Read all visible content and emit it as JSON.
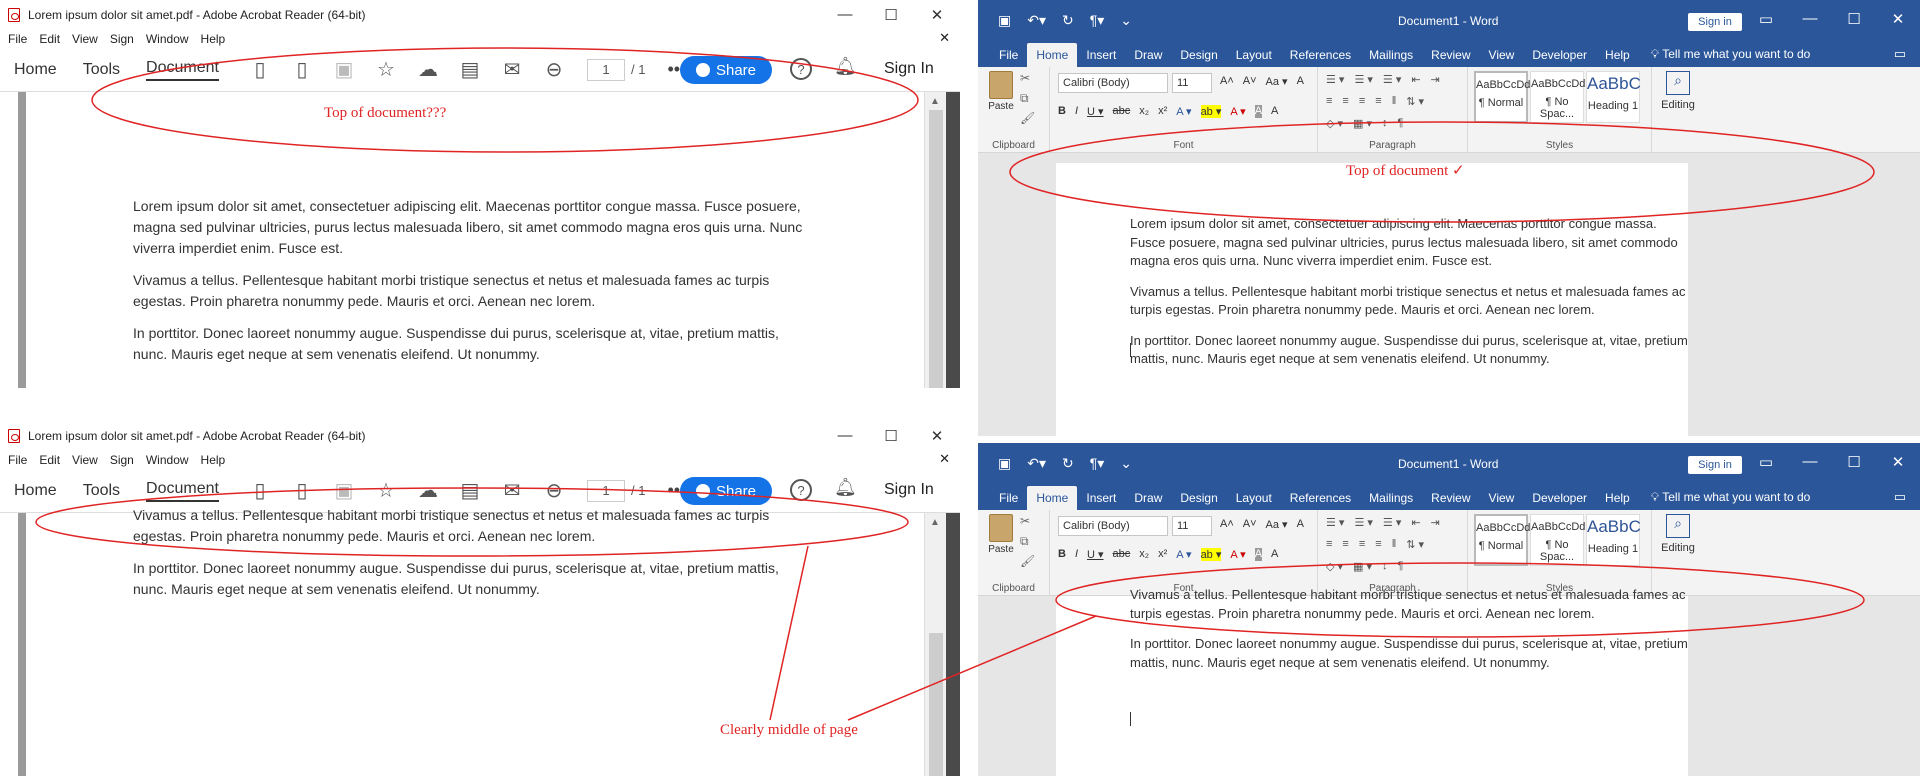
{
  "acrobat": {
    "title": "Lorem ipsum dolor sit amet.pdf - Adobe Acrobat Reader (64-bit)",
    "window_controls": [
      "—",
      "☐",
      "✕"
    ],
    "menu": [
      "File",
      "Edit",
      "View",
      "Sign",
      "Window",
      "Help"
    ],
    "menu_close": "✕",
    "nav": [
      "Home",
      "Tools",
      "Document"
    ],
    "page_current": "1",
    "page_total": "/ 1",
    "more": "•••",
    "share_label": "Share",
    "help_label": "?",
    "signin_label": "Sign In",
    "paragraphs": [
      "Lorem ipsum dolor sit amet, consectetuer adipiscing elit. Maecenas porttitor congue massa. Fusce posuere, magna sed pulvinar ultricies, purus lectus malesuada libero, sit amet commodo magna eros quis urna. Nunc viverra imperdiet enim. Fusce est.",
      "Vivamus a tellus. Pellentesque habitant morbi tristique senectus et netus et malesuada fames ac turpis egestas. Proin pharetra nonummy pede. Mauris et orci. Aenean nec lorem.",
      "In porttitor. Donec laoreet nonummy augue. Suspendisse dui purus, scelerisque at, vitae, pretium mattis, nunc. Mauris eget neque at sem venenatis eleifend. Ut nonummy."
    ],
    "scrolled_paragraphs": [
      "Vivamus a tellus. Pellentesque habitant morbi tristique senectus et netus et malesuada fames ac turpis egestas. Proin pharetra nonummy pede. Mauris et orci. Aenean nec lorem.",
      "In porttitor. Donec laoreet nonummy augue. Suspendisse dui purus, scelerisque at, vitae, pretium mattis, nunc. Mauris eget neque at sem venenatis eleifend. Ut nonummy."
    ]
  },
  "word": {
    "doc_title": "Document1 - Word",
    "signin_label": "Sign in",
    "window_controls": [
      "▭",
      "—",
      "☐",
      "✕"
    ],
    "tabs": [
      "File",
      "Home",
      "Insert",
      "Draw",
      "Design",
      "Layout",
      "References",
      "Mailings",
      "Review",
      "View",
      "Developer",
      "Help"
    ],
    "tell_me": "Tell me what you want to do",
    "paste_label": "Paste",
    "font_name": "Calibri (Body)",
    "font_size": "11",
    "font_tools": [
      "A˄",
      "A˅",
      "Aa ▾",
      "A"
    ],
    "format_tools": [
      "B",
      "I",
      "U ▾",
      "abc",
      "x₂",
      "x²",
      "A ▾",
      "ab ▾",
      "A ▾",
      "A",
      "A"
    ],
    "para_tools": [
      "☰ ▾",
      "☰ ▾",
      "☰ ▾",
      "⇤",
      "⇥",
      "↕",
      "¶"
    ],
    "para_tools2": [
      "≡",
      "≡",
      "≡",
      "≡",
      "‖",
      "⇅ ▾",
      "◇ ▾",
      "▦ ▾"
    ],
    "groups": [
      "Clipboard",
      "Font",
      "Paragraph",
      "Styles"
    ],
    "styles": [
      {
        "preview": "AaBbCcDd",
        "name": "¶ Normal"
      },
      {
        "preview": "AaBbCcDd",
        "name": "¶ No Spac..."
      },
      {
        "preview": "AaBbC",
        "name": "Heading 1"
      }
    ],
    "editing_label": "Editing",
    "paragraphs": [
      "Lorem ipsum dolor sit amet, consectetuer adipiscing elit. Maecenas porttitor congue massa. Fusce posuere, magna sed pulvinar ultricies, purus lectus malesuada libero, sit amet commodo magna eros quis urna. Nunc viverra imperdiet enim. Fusce est.",
      "Vivamus a tellus. Pellentesque habitant morbi tristique senectus et netus et malesuada fames ac turpis egestas. Proin pharetra nonummy pede. Mauris et orci. Aenean nec lorem.",
      "In porttitor. Donec laoreet nonummy augue. Suspendisse dui purus, scelerisque at, vitae, pretium mattis, nunc. Mauris eget neque at sem venenatis eleifend. Ut nonummy."
    ],
    "scrolled_paragraphs": [
      "Vivamus a tellus. Pellentesque habitant morbi tristique senectus et netus et malesuada fames ac turpis egestas. Proin pharetra nonummy pede. Mauris et orci. Aenean nec lorem.",
      "In porttitor. Donec laoreet nonummy augue. Suspendisse dui purus, scelerisque at, vitae, pretium mattis, nunc. Mauris eget neque at sem venenatis eleifend. Ut nonummy."
    ]
  },
  "annotations": {
    "acrobat_top": "Top of document???",
    "word_top": "Top of document ✓",
    "middle": "Clearly middle of page",
    "color": "#e02424"
  },
  "colors": {
    "word_blue": "#2b579a",
    "share_blue": "#1473e6"
  }
}
